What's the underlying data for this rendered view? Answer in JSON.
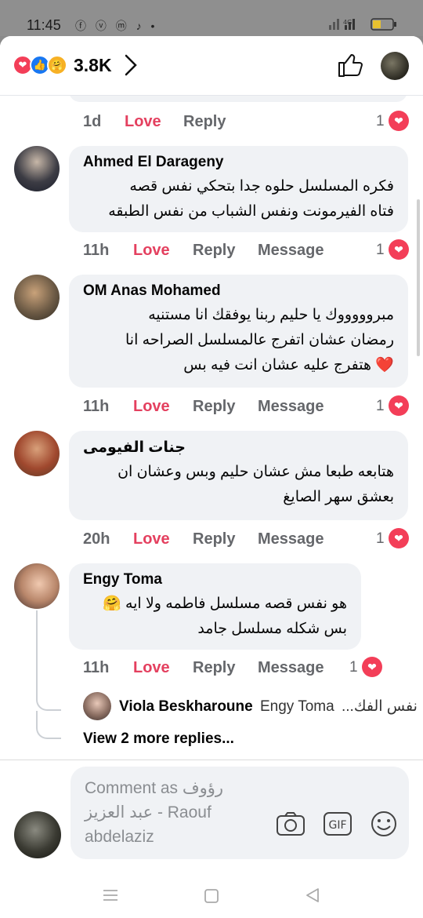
{
  "status_bar": {
    "time": "11:45",
    "apps": "ⓕ ⓥ ⓜ ♪ •",
    "network": "4G"
  },
  "header": {
    "reaction_count": "3.8K",
    "reactions": [
      "love",
      "like",
      "care"
    ]
  },
  "previous_comment": {
    "time": "1d",
    "love_label": "Love",
    "reply_label": "Reply",
    "reaction_count": "1"
  },
  "comments": [
    {
      "author": "Ahmed El Darageny",
      "lines": [
        "فكره المسلسل حلوه جدا  بتحكي نفس قصه",
        "فتاه الفيرمونت ونفس الشباب من نفس الطبقه"
      ],
      "time": "11h",
      "love_label": "Love",
      "reply_label": "Reply",
      "message_label": "Message",
      "reaction_count": "1"
    },
    {
      "author": "OM Anas Mohamed",
      "lines": [
        "مبروووووك يا حليم ربنا يوفقك انا مستنيه",
        "رمضان عشان اتفرج عالمسلسل الصراحه انا",
        "هتفرج عليه عشان انت فيه بس"
      ],
      "time": "11h",
      "love_label": "Love",
      "reply_label": "Reply",
      "message_label": "Message",
      "reaction_count": "1"
    },
    {
      "author": "جنات الفيومى",
      "lines": [
        "هتابعه طبعا مش عشان حليم وبس وعشان ان",
        "بعشق سهر الصايغ"
      ],
      "time": "20h",
      "love_label": "Love",
      "reply_label": "Reply",
      "message_label": "Message",
      "reaction_count": "1"
    },
    {
      "author": "Engy Toma",
      "lines": [
        "هو نفس قصه مسلسل فاطمه ولا ايه",
        "بس شكله مسلسل جامد"
      ],
      "time": "11h",
      "love_label": "Love",
      "reply_label": "Reply",
      "message_label": "Message",
      "reaction_count": "1"
    }
  ],
  "reply_preview": {
    "author": "Viola Beskharoune",
    "mention": "Engy Toma",
    "text": "نفس الفك..."
  },
  "view_more": "View 2 more replies...",
  "composer": {
    "placeholder_line1": "Comment as رؤوف",
    "placeholder_line2": "عبد العزيز - Raouf",
    "placeholder_line3": "abdelaziz",
    "gif_label": "GIF"
  },
  "colors": {
    "love": "#e4405f",
    "bubble": "#f0f2f5",
    "muted": "#65676b",
    "heart": "#f33e58"
  }
}
